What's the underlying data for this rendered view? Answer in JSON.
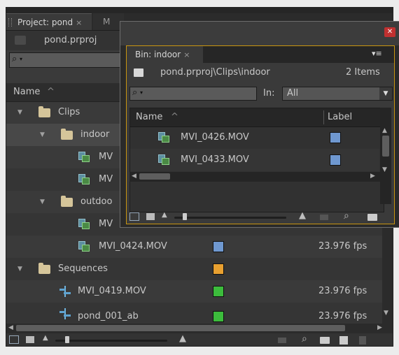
{
  "project": {
    "tab_label": "Project: pond",
    "tab_close": "×",
    "other_tab_label": "M",
    "file_name": "pond.prproj",
    "search_glyph": "⌕",
    "header_name": "Name",
    "header_sort": "^",
    "rows": [
      {
        "name": "Clips",
        "type": "folder",
        "level": 0
      },
      {
        "name": "indoor",
        "type": "folder",
        "level": 1
      },
      {
        "name": "MV",
        "type": "clip",
        "level": 2
      },
      {
        "name": "MV",
        "type": "clip",
        "level": 2
      },
      {
        "name": "outdoo",
        "type": "folder",
        "level": 1
      },
      {
        "name": "MV",
        "type": "clip",
        "level": 2
      },
      {
        "name": "MVI_0424.MOV",
        "type": "clip",
        "level": 2,
        "label_color": "#6f98d0",
        "fps": "23.976 fps"
      },
      {
        "name": "Sequences",
        "type": "folder",
        "level": 0,
        "label_color": "#e8a030"
      },
      {
        "name": "MVI_0419.MOV",
        "type": "sequence",
        "level": 1,
        "label_color": "#3cbc3c",
        "fps": "23.976 fps"
      },
      {
        "name": "pond_001_ab",
        "type": "sequence",
        "level": 1,
        "label_color": "#3cbc3c",
        "fps": "23.976 fps"
      }
    ]
  },
  "bin": {
    "tab_label": "Bin: indoor",
    "tab_close": "×",
    "panel_menu": "▾≡",
    "path": "pond.prproj\\Clips\\indoor",
    "item_count": "2 Items",
    "in_label": "In:",
    "in_value": "All",
    "header_name": "Name",
    "header_sort": "^",
    "header_label": "Label",
    "rows": [
      {
        "name": "MVI_0426.MOV",
        "label_color": "#6f98d0"
      },
      {
        "name": "MVI_0433.MOV",
        "label_color": "#6f98d0"
      }
    ]
  },
  "colors": {
    "panel_bg": "#3a3a3a",
    "bin_frame": "#c99510",
    "close_red": "#c03030"
  }
}
